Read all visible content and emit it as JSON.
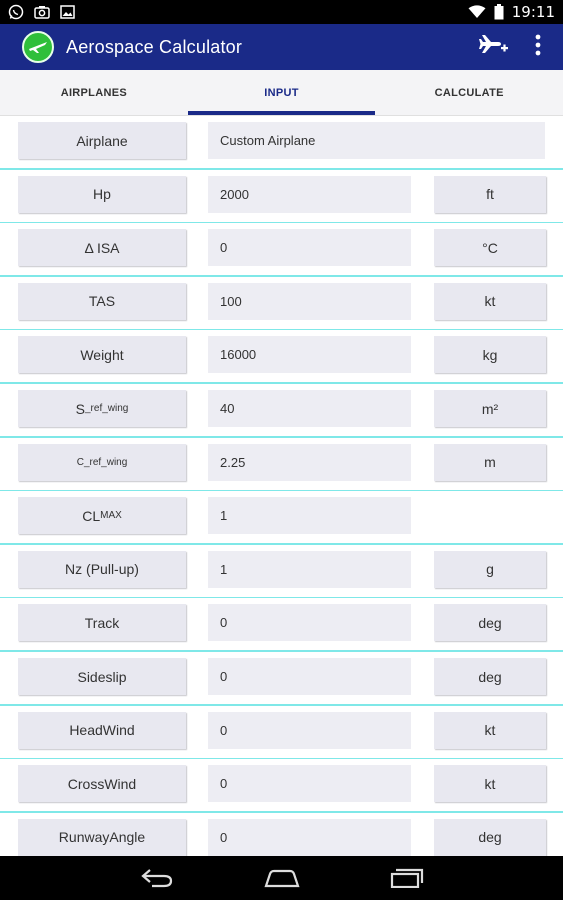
{
  "status_bar": {
    "time": "19:11",
    "left_icons": [
      "whatsapp-icon",
      "camera-icon",
      "image-icon"
    ],
    "right_icons": [
      "wifi-icon",
      "battery-icon"
    ]
  },
  "app": {
    "title": "Aerospace Calculator",
    "logo_icon": "airplane-logo-icon",
    "actions": [
      "add-airplane-icon",
      "overflow-menu-icon"
    ],
    "brand_color": "#1a2a88",
    "logo_color": "#2fbf3a"
  },
  "tabs": [
    {
      "label": "AIRPLANES",
      "active": false
    },
    {
      "label": "INPUT",
      "active": true
    },
    {
      "label": "CALCULATE",
      "active": false
    }
  ],
  "rows": [
    {
      "label": "Airplane",
      "value": "Custom Airplane",
      "unit": ""
    },
    {
      "label": "Hp",
      "value": "2000",
      "unit": "ft"
    },
    {
      "label": "Δ ISA",
      "value": "0",
      "unit": "°C"
    },
    {
      "label": "TAS",
      "value": "100",
      "unit": "kt"
    },
    {
      "label": "Weight",
      "value": "16000",
      "unit": "kg"
    },
    {
      "label_main": "S",
      "label_sub": "_ref_wing",
      "value": "40",
      "unit": "m²"
    },
    {
      "label_main": "C",
      "label_sub": "_ref_wing",
      "value": "2.25",
      "unit": "m"
    },
    {
      "label_main": "CL",
      "label_sub": "MAX",
      "value": "1",
      "unit": ""
    },
    {
      "label": "Nz (Pull-up)",
      "value": "1",
      "unit": "g"
    },
    {
      "label": "Track",
      "value": "0",
      "unit": "deg"
    },
    {
      "label": "Sideslip",
      "value": "0",
      "unit": "deg"
    },
    {
      "label": "HeadWind",
      "value": "0",
      "unit": "kt"
    },
    {
      "label": "CrossWind",
      "value": "0",
      "unit": "kt"
    },
    {
      "label": "RunwayAngle",
      "value": "0",
      "unit": "deg"
    }
  ],
  "nav_bar": {
    "buttons": [
      "back-icon",
      "home-icon",
      "recents-icon"
    ]
  }
}
